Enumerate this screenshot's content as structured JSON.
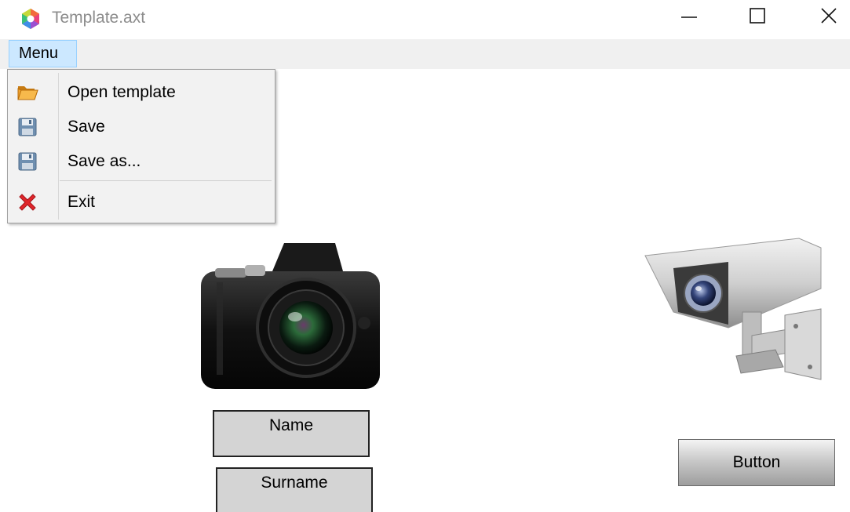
{
  "window": {
    "title": "Template.axt",
    "controls": [
      "minimize-icon",
      "maximize-icon",
      "close-icon"
    ]
  },
  "menubar": {
    "menu_label": "Menu"
  },
  "menu": {
    "items": [
      {
        "label": "Open template",
        "icon": "folder-open-icon"
      },
      {
        "label": "Save",
        "icon": "floppy-disk-icon"
      },
      {
        "label": "Save as...",
        "icon": "floppy-disk-icon"
      },
      {
        "label": "Exit",
        "icon": "red-x-icon"
      }
    ]
  },
  "canvas": {
    "images": [
      "camera-image",
      "security-camera-image"
    ],
    "name_label": "Name",
    "surname_label": "Surname",
    "button_label": "Button"
  },
  "colors": {
    "menu_highlight": "#cce8ff",
    "menu_highlight_border": "#99d1ff",
    "menubar_bg": "#f0f0f0",
    "field_bg": "#d4d4d4",
    "title_text": "#8c8c8c"
  }
}
